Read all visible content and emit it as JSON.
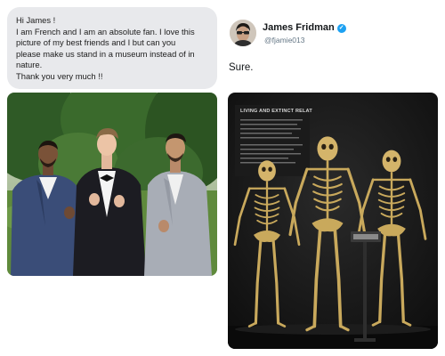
{
  "request": {
    "lines": [
      "Hi James !",
      "I am French and I am an absolute fan. I love this",
      "picture of my best friends and I but can you",
      "please make us stand in a museum instead of in",
      "nature.",
      "Thank you very much !!"
    ]
  },
  "reply_post": {
    "author_name": "James Fridman",
    "handle": "@fjamie013",
    "text": "Sure."
  },
  "museum_photo": {
    "display_title": "LIVING AND EXTINCT RELAT"
  },
  "colors": {
    "bubble": "#e8e9ec",
    "verified_badge": "#1da1f2",
    "museum_bg": "#161616",
    "bone": "#c9a95c"
  }
}
